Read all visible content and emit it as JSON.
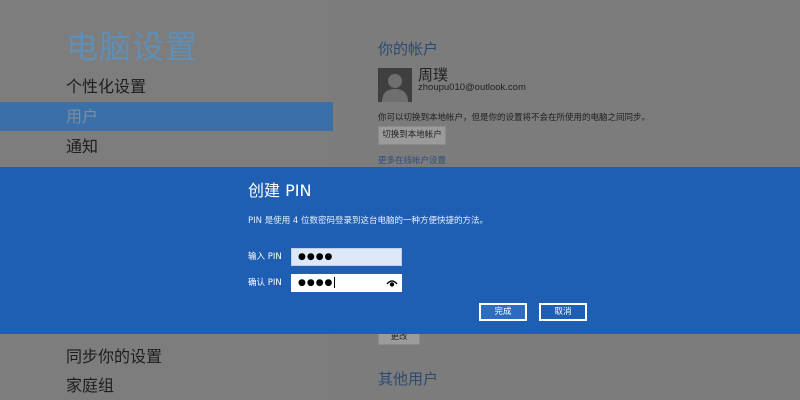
{
  "left": {
    "page_title": "电脑设置",
    "nav_items": [
      {
        "label": "个性化设置"
      },
      {
        "label": "用户"
      },
      {
        "label": "通知"
      },
      {
        "label": "同步你的设置"
      },
      {
        "label": "家庭组"
      }
    ]
  },
  "account": {
    "section_title": "你的帐户",
    "user_name": "周璞",
    "email": "zhoupu010@outlook.com",
    "info": "你可以切换到本地帐户，但是你的设置将不会在所使用的电脑之间同步。",
    "switch_button": "切换到本地帐户",
    "more_link": "更多在线帐户设置",
    "change_button": "更改"
  },
  "other_users": {
    "section_title": "其他用户"
  },
  "modal": {
    "title": "创建 PIN",
    "description": "PIN 是使用 4 位数密码登录到这台电脑的一种方便快捷的方法。",
    "enter_label": "输入 PIN",
    "enter_value": "●●●●",
    "confirm_label": "确认 PIN",
    "confirm_value": "●●●●",
    "ok_button": "完成",
    "cancel_button": "取消"
  },
  "colors": {
    "modal_bg": "#1e5fb3",
    "nav_active": "#3a70a7",
    "title_blue": "#5f8fb6"
  },
  "icons": [
    "avatar-silhouette-icon",
    "eye-reveal-icon"
  ]
}
